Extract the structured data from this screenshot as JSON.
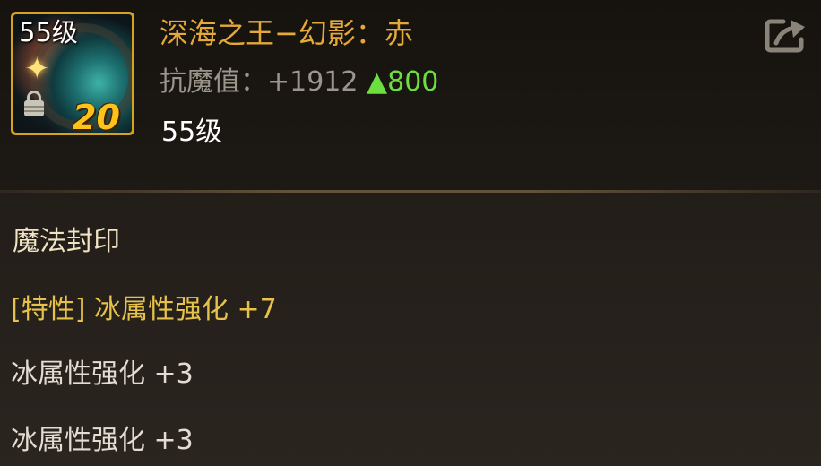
{
  "item": {
    "icon_level": "55级",
    "icon_reinforce": "20",
    "name": "深海之王−幻影：赤",
    "stat_label": "抗魔值：",
    "stat_value": "+1912",
    "stat_up": "▲800",
    "level": "55级"
  },
  "section": {
    "title": "魔法封印",
    "attributes": [
      "[特性] 冰属性强化 +7",
      "冰属性强化 +3",
      "冰属性强化 +3"
    ]
  },
  "icons": {
    "share": "share-icon",
    "lock": "lock-icon",
    "sparkle": "sparkle-icon"
  },
  "colors": {
    "name": "#e5a93a",
    "special_attribute": "#e6c24a",
    "increase": "#6cde3f",
    "frame": "#d8a21c"
  }
}
